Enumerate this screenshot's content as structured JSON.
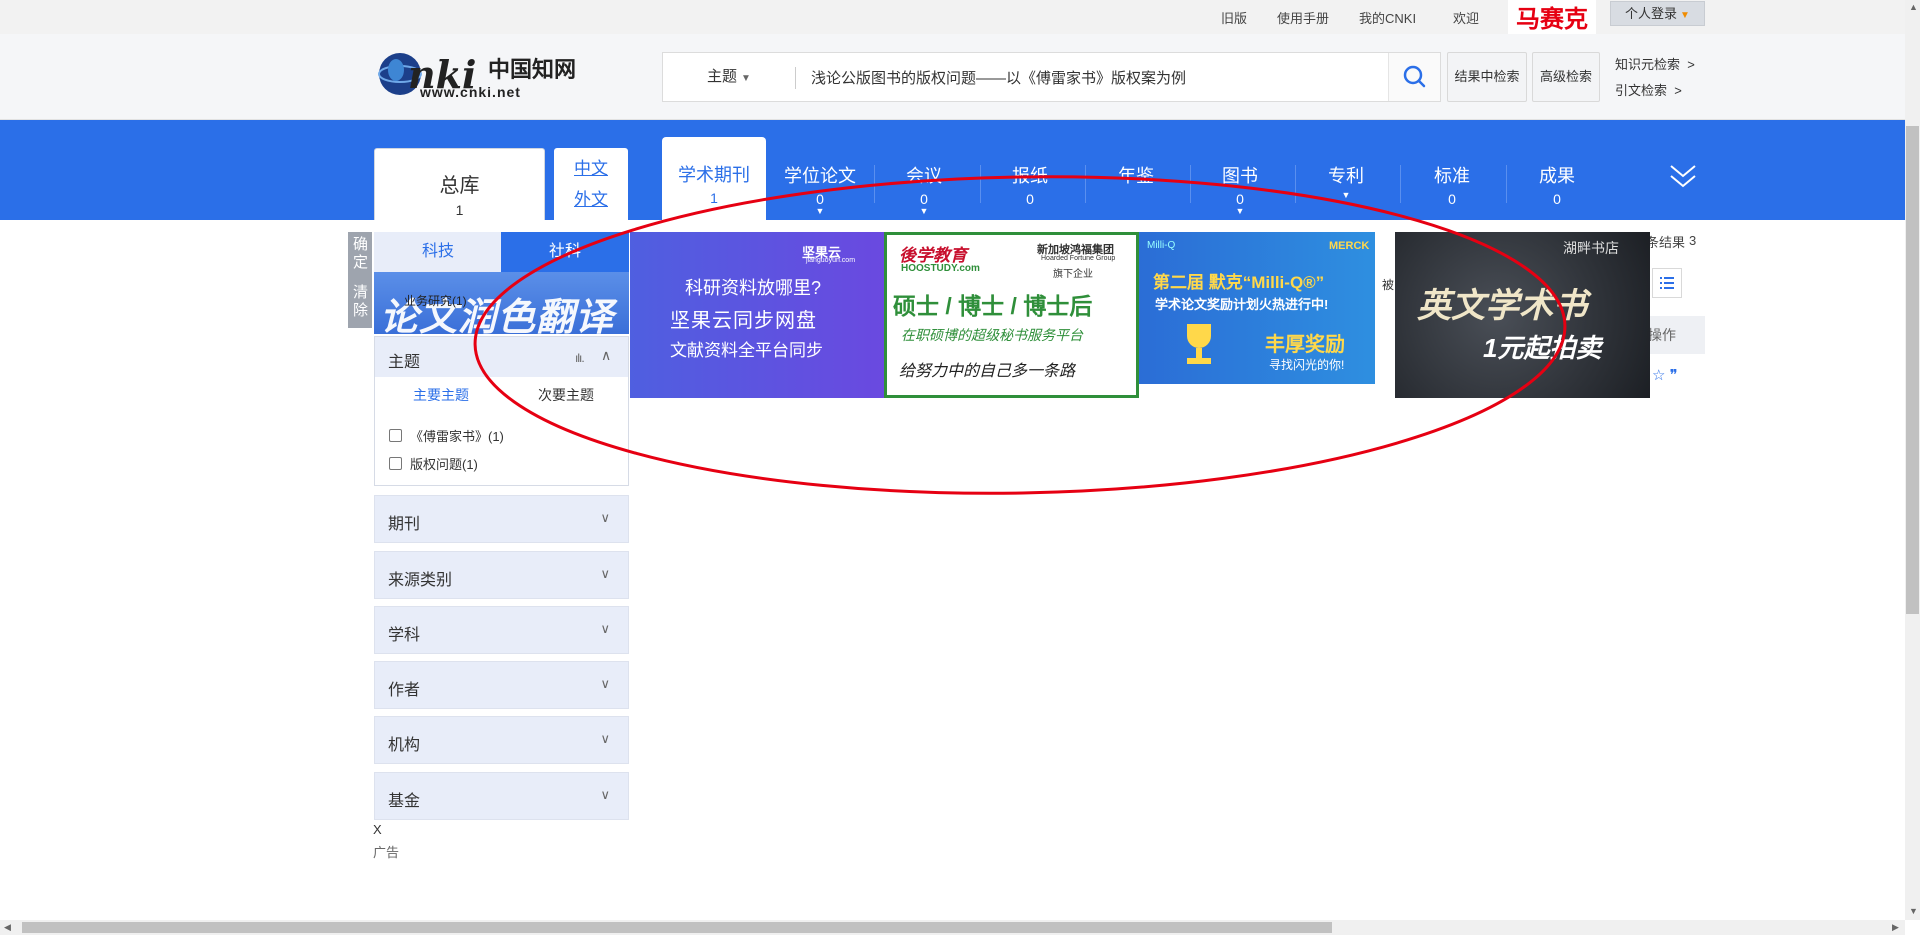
{
  "topbar": {
    "links": [
      "旧版",
      "使用手册",
      "我的CNKI",
      "欢迎"
    ],
    "username": "马赛克",
    "login_label": "个人登录"
  },
  "header": {
    "logo_cn": "中国知网",
    "logo_url": "www.cnki.net",
    "search_type": "主题",
    "search_value": "浅论公版图书的版权问题——以《傅雷家书》版权案为例",
    "btn_in_results": "结果中检索",
    "btn_advanced": "高级检索",
    "knowledge_search": "知识元检索",
    "citation_search": "引文检索"
  },
  "nav": {
    "zongku_label": "总库",
    "zongku_count": "1",
    "lang_zh": "中文",
    "lang_en": "外文",
    "tabs": [
      {
        "label": "学术期刊",
        "count": "1",
        "active": true,
        "dropdown": false
      },
      {
        "label": "学位论文",
        "count": "0",
        "dropdown": true
      },
      {
        "label": "会议",
        "count": "0",
        "dropdown": true
      },
      {
        "label": "报纸",
        "count": "0",
        "dropdown": false
      },
      {
        "label": "年鉴",
        "count": "",
        "dropdown": false
      },
      {
        "label": "图书",
        "count": "0",
        "dropdown": true
      },
      {
        "label": "专利",
        "count": "",
        "dropdown": true
      },
      {
        "label": "标准",
        "count": "0",
        "dropdown": false
      },
      {
        "label": "成果",
        "count": "0",
        "dropdown": false
      }
    ]
  },
  "sidebar": {
    "confirm": "确定",
    "clear": "清除",
    "tab_sci": "科技",
    "tab_social": "社科",
    "translate_ad_text": "论文润色翻译",
    "translate_ad_overlay": "业务研究(1)",
    "topic_title": "主题",
    "topic_main": "主要主题",
    "topic_secondary": "次要主题",
    "topic_items": [
      "《傅雷家书》(1)",
      "版权问题(1)"
    ],
    "facets": [
      "期刊",
      "来源类别",
      "学科",
      "作者",
      "机构",
      "基金"
    ],
    "close_x": "X",
    "ad_label": "广告"
  },
  "results": {
    "label": "条结果",
    "count": "3",
    "op_header": "操作",
    "side_text": "被"
  },
  "ads": {
    "ad1": {
      "brand": "坚果云",
      "brand_sub": "jianguoyun.com",
      "line1": "科研资料放哪里?",
      "line2": "坚果云同步网盘",
      "line3": "文献资料全平台同步"
    },
    "ad2": {
      "brand": "後学教育",
      "brand_en": "HOOSTUDY.com",
      "group": "新加坡鸿福集团",
      "group_en": "Hoarded Fortune Group",
      "sub": "旗下企业",
      "line1": "硕士 / 博士 / 博士后",
      "line2": "在职硕博的超级秘书服务平台",
      "line3": "给努力中的自己多一条路"
    },
    "ad3": {
      "brand_left": "Milli-Q",
      "brand_right": "MERCK",
      "line1": "第二届 默克“Milli-Q®”",
      "line2": "学术论文奖励计划火热进行中!",
      "line3": "丰厚奖励",
      "line4": "寻找闪光的你!"
    },
    "ad4": {
      "brand": "湖畔书店",
      "line1": "英文学术书",
      "line2": "1元起拍卖"
    }
  },
  "colors": {
    "nav_blue": "#2b6fe8",
    "annotation_red": "#e60012"
  }
}
